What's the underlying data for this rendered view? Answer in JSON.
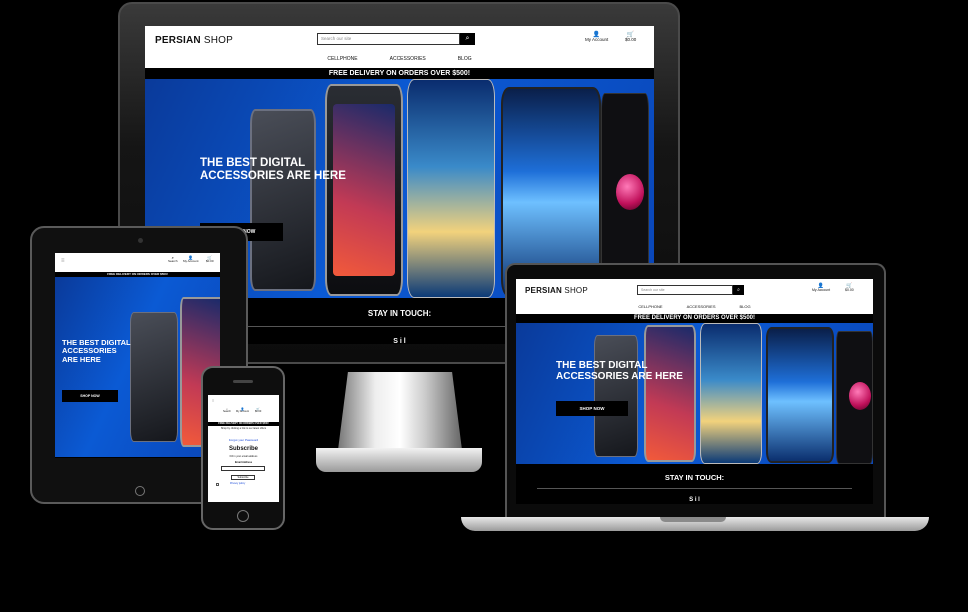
{
  "site": {
    "logo_primary": "PERSIAN",
    "logo_secondary": "SHOP",
    "search_placeholder": "Search our site",
    "search_icon_glyph": "⌕",
    "search_label": "Search",
    "account_label": "My Account",
    "account_icon_glyph": "👤",
    "cart_amount": "$0.00",
    "cart_icon_glyph": "🛒",
    "menu_icon_glyph": "≡",
    "nav": [
      "CELLPHONE",
      "ACCESSORIES",
      "BLOG"
    ],
    "banner": "FREE DELIVERY ON ORDERS OVER $500!",
    "hero_title": "THE BEST DIGITAL ACCESSORIES ARE HERE",
    "shop_button": "SHOP NOW",
    "stay_in_touch": "STAY IN TOUCH:",
    "social_partial": "S i l"
  },
  "phone_view": {
    "partial_text": "Shop by clicking a link to our latest offers",
    "offers_link": "Offers",
    "password_link": "Forgot your Password",
    "subscribe_heading": "Subscribe",
    "email_prompt": "Fill in your email address",
    "email_label": "Email Address",
    "subscribe_button": "Subscribe",
    "privacy_text": "Privacy policy"
  },
  "colors": {
    "brand_black": "#000000",
    "hero_blue": "#0b5ad4",
    "background": "#000000"
  }
}
